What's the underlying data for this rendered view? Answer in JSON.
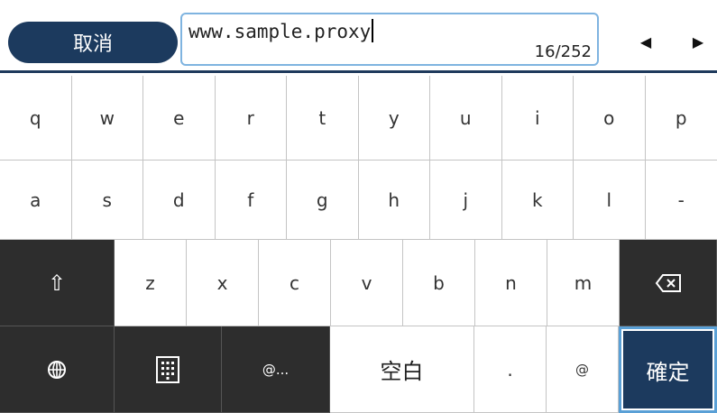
{
  "top_bar": {
    "cancel_label": "取消",
    "field_value": "www.sample.proxy",
    "char_counter": "16/252",
    "arrow_left": "◀",
    "arrow_right": "▶"
  },
  "keyboard": {
    "row1": [
      "q",
      "w",
      "e",
      "r",
      "t",
      "y",
      "u",
      "i",
      "o",
      "p"
    ],
    "row2": [
      "a",
      "s",
      "d",
      "f",
      "g",
      "h",
      "j",
      "k",
      "l",
      "-"
    ],
    "row3": [
      "z",
      "x",
      "c",
      "v",
      "b",
      "n",
      "m"
    ],
    "shift_icon": "⇧",
    "backspace_icon": "backspace-icon",
    "globe_icon": "globe-icon",
    "keypad_icon": "keypad-icon",
    "at_ellipsis_label": "@...",
    "space_label": "空白",
    "period_label": ".",
    "at_label": "@",
    "confirm_label": "確定"
  },
  "colors": {
    "accent_dark": "#1c3a5e",
    "field_border": "#7fb4e0",
    "dark_key": "#2d2d2d",
    "focus_border": "#5aa0d6"
  }
}
